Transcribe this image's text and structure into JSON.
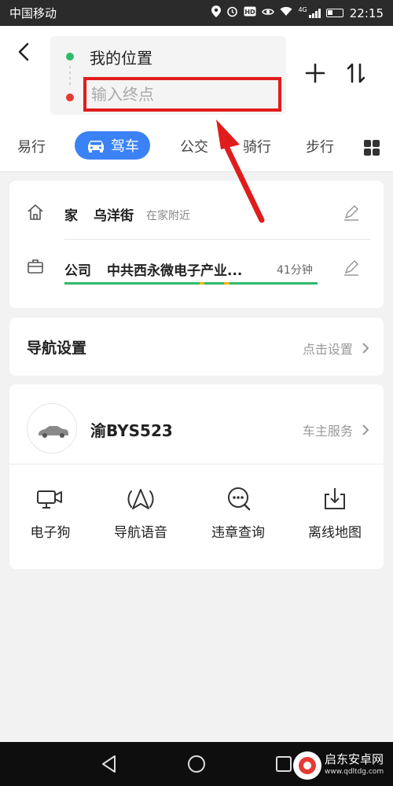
{
  "status": {
    "carrier": "中国移动",
    "network": "4G",
    "time": "22:15"
  },
  "header": {
    "start": "我的位置",
    "dest_placeholder": "输入终点"
  },
  "tabs": [
    {
      "label": "易行"
    },
    {
      "label": "驾车",
      "active": true
    },
    {
      "label": "公交"
    },
    {
      "label": "骑行"
    },
    {
      "label": "步行"
    }
  ],
  "places": {
    "home": {
      "label": "家",
      "addr": "乌洋街",
      "note": "在家附近"
    },
    "work": {
      "label": "公司",
      "addr": "中共西永微电子产业...",
      "eta": "41分钟"
    }
  },
  "nav_settings": {
    "title": "导航设置",
    "action": "点击设置"
  },
  "car": {
    "plate": "渝BYS523",
    "owner_service": "车主服务"
  },
  "tools": [
    {
      "label": "电子狗",
      "icon": "dashcam-icon"
    },
    {
      "label": "导航语音",
      "icon": "voice-broadcast-icon"
    },
    {
      "label": "违章查询",
      "icon": "violation-query-icon"
    },
    {
      "label": "离线地图",
      "icon": "download-map-icon"
    }
  ],
  "watermark": {
    "name": "启东安卓网",
    "url": "www.qdltdg.com"
  },
  "colors": {
    "accent": "#3b82f6",
    "start_dot": "#2dbb6a",
    "end_dot": "#e53935",
    "highlight": "#e01d1d"
  }
}
